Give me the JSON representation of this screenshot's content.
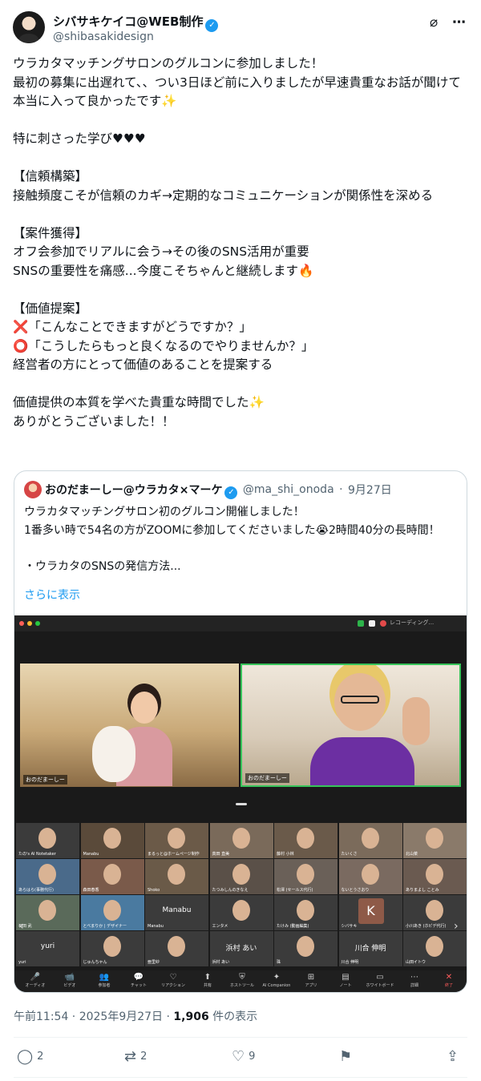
{
  "author": {
    "name": "シバサキケイコ@WEB制作",
    "handle": "@shibasakidesign"
  },
  "tweet_text": "ウラカタマッチングサロンのグルコンに参加しました！\n最初の募集に出遅れて、、つい3日ほど前に入りましたが早速貴重なお話が聞けて本当に入って良かったです✨\n\n特に刺さった学び♥♥♥\n\n【信頼構築】\n接触頻度こそが信頼のカギ→定期的なコミュニケーションが関係性を深める\n\n【案件獲得】\nオフ会参加でリアルに会う→その後のSNS活用が重要\nSNSの重要性を痛感...今度こそちゃんと継続します🔥\n\n【価値提案】\n❌「こんなことできますがどうですか？」\n⭕「こうしたらもっと良くなるのでやりませんか？」\n経営者の方にとって価値のあることを提案する\n\n価値提供の本質を学べた貴重な時間でした✨\nありがとうございました！！",
  "quote": {
    "name": "おのだまーしー@ウラカタ×マーケ",
    "handle": "@ma_shi_onoda",
    "date": "9月27日",
    "text": "ウラカタマッチングサロン初のグルコン開催しました！\n1番多い時で54名の方がZOOMに参加してくださいました😭2時間40分の長時間！\n\n・ウラカタのSNSの発信方法...",
    "show_more": "さらに表示"
  },
  "zoom": {
    "recording_label": "レコーディング...",
    "main_tiles": [
      "おのだまーしー",
      "おのだまーしー"
    ],
    "grid_cells": [
      {
        "name": "たの's AI Notetaker",
        "big": "",
        "color": "#3b3b3b"
      },
      {
        "name": "Manabu",
        "big": "",
        "color": "#5a4a3a"
      },
      {
        "name": "まるっと@ホームページ制作",
        "big": "",
        "color": "#6b5a48"
      },
      {
        "name": "真田 直美",
        "big": "",
        "color": "#7a6a5a"
      },
      {
        "name": "藤村 小林",
        "big": "",
        "color": "#6a5a4a"
      },
      {
        "name": "たいくさ",
        "big": "",
        "color": "#7b6b5b"
      },
      {
        "name": "北山菜",
        "big": "",
        "color": "#8a7a6a"
      },
      {
        "name": "あらはら(事務代行)",
        "big": "",
        "color": "#4a6a8a"
      },
      {
        "name": "森田春香",
        "big": "",
        "color": "#7a5a4a"
      },
      {
        "name": "Shoko",
        "big": "",
        "color": "#6a5a48"
      },
      {
        "name": "たつみしんのきなえ",
        "big": "",
        "color": "#5a5048"
      },
      {
        "name": "松澤 (セールス代行)",
        "big": "",
        "color": "#6a6058"
      },
      {
        "name": "ないとうさおり",
        "big": "",
        "color": "#7a6a60"
      },
      {
        "name": "ありまよし ことみ",
        "big": "",
        "color": "#6a5a50"
      },
      {
        "name": "石田 武",
        "big": "",
        "color": "#5a6a5a"
      },
      {
        "name": "とべまりか | デザイナー",
        "big": "",
        "color": "#4a7aa0"
      },
      {
        "name": "Manabu",
        "big": "Manabu",
        "color": "#3b3b3b"
      },
      {
        "name": "エンタメ",
        "big": "",
        "color": "#3b3b3b"
      },
      {
        "name": "たけみ (動画編集)",
        "big": "",
        "color": "#3b3b3b"
      },
      {
        "name": "シバサキ",
        "big": "",
        "color": "#3b3b3b"
      },
      {
        "name": "小川あき (ホビデ代行)",
        "big": "",
        "color": "#3b3b3b"
      },
      {
        "name": "yuri",
        "big": "yuri",
        "color": "#3b3b3b"
      },
      {
        "name": "じゅんちゃん",
        "big": "",
        "color": "#3b3b3b"
      },
      {
        "name": "亜里紗",
        "big": "",
        "color": "#3b3b3b"
      },
      {
        "name": "浜村 あい",
        "big": "浜村 あい",
        "color": "#3b3b3b"
      },
      {
        "name": "珠",
        "big": "",
        "color": "#3b3b3b"
      },
      {
        "name": "川合 伸明",
        "big": "川合 伸明",
        "color": "#3b3b3b"
      },
      {
        "name": "山田イトウ",
        "big": "",
        "color": "#3b3b3b"
      }
    ],
    "toolbar": [
      {
        "icon": "🎤",
        "label": "オーディオ"
      },
      {
        "icon": "📹",
        "label": "ビデオ"
      },
      {
        "icon": "👥",
        "label": "参加者"
      },
      {
        "icon": "💬",
        "label": "チャット"
      },
      {
        "icon": "♡",
        "label": "リアクション"
      },
      {
        "icon": "⬆",
        "label": "共有"
      },
      {
        "icon": "⛨",
        "label": "ホストツール"
      },
      {
        "icon": "✦",
        "label": "AI Companion"
      },
      {
        "icon": "⊞",
        "label": "アプリ"
      },
      {
        "icon": "▤",
        "label": "ノート"
      },
      {
        "icon": "▭",
        "label": "ホワイトボード"
      },
      {
        "icon": "⋯",
        "label": "詳細"
      },
      {
        "icon": "✕",
        "label": "終了"
      }
    ]
  },
  "meta": {
    "time": "午前11:54 · 2025年9月27日 · ",
    "views": "1,906",
    "views_suffix": " 件の表示"
  },
  "actions": {
    "replies": "2",
    "reposts": "2",
    "likes": "9"
  }
}
